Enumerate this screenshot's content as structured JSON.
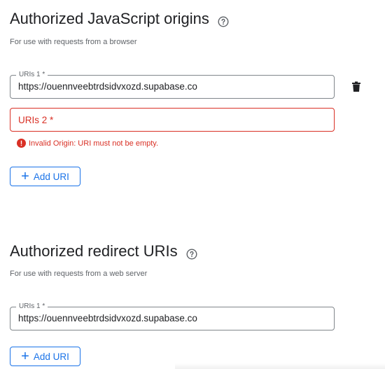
{
  "origins_section": {
    "title": "Authorized JavaScript origins",
    "subtitle": "For use with requests from a browser",
    "uri1_label": "URIs 1 *",
    "uri1_value": "https://ouennveebtrdsidvxozd.supabase.co",
    "uri2_label": "URIs 2 *",
    "error_message": "Invalid Origin: URI must not be empty.",
    "add_button_label": "Add URI"
  },
  "redirect_section": {
    "title": "Authorized redirect URIs",
    "subtitle": "For use with requests from a web server",
    "uri1_label": "URIs 1 *",
    "uri1_value": "https://ouennveebtrdsidvxozd.supabase.co",
    "add_button_label": "Add URI"
  },
  "icons": {
    "help": "help-circle-icon",
    "delete": "trash-icon",
    "error": "error-circle-icon",
    "add": "plus-icon"
  },
  "colors": {
    "accent": "#1a73e8",
    "error": "#d93025",
    "text": "#202124",
    "muted": "#5f6368"
  }
}
